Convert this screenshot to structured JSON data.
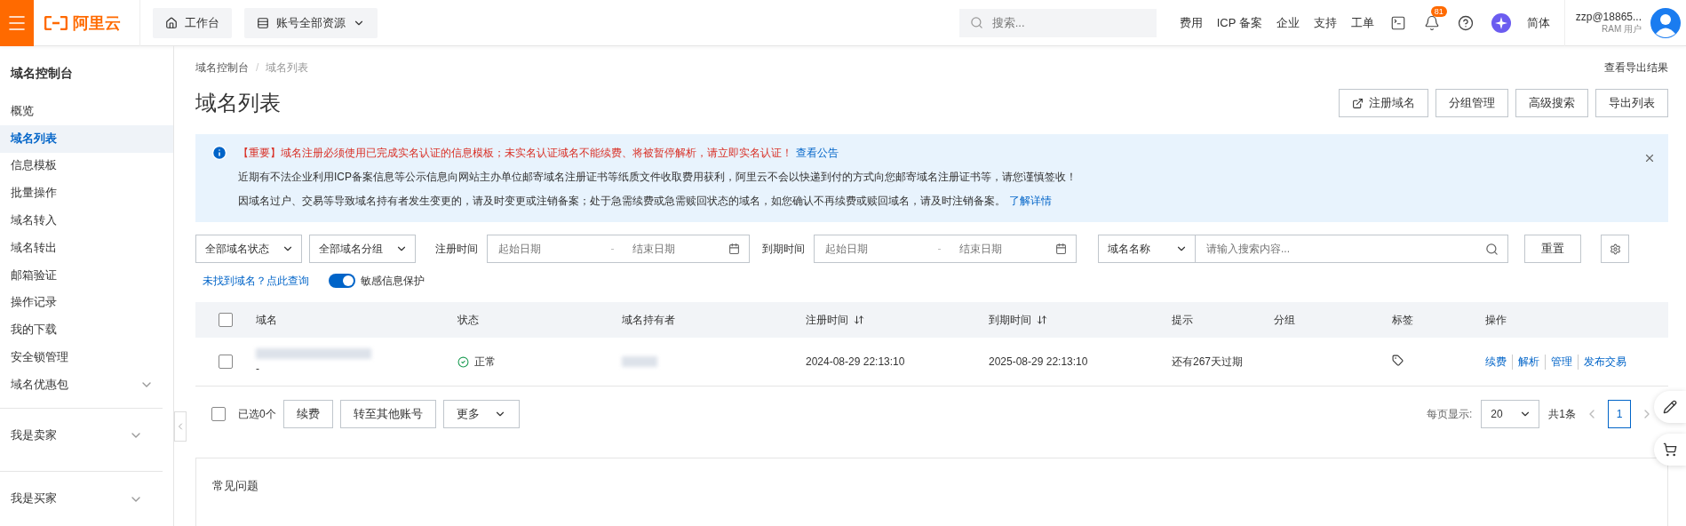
{
  "topbar": {
    "logo": "阿里云",
    "nav_buttons": [
      {
        "label": "工作台",
        "kind": "home"
      },
      {
        "label": "账号全部资源",
        "kind": "dropdown"
      }
    ],
    "search": {
      "placeholder": "搜索..."
    },
    "links": [
      "费用",
      "ICP 备案",
      "企业",
      "支持",
      "工单"
    ],
    "notification_badge": "81",
    "language": "简体",
    "user": {
      "name": "zzp@18865...",
      "role": "RAM 用户"
    }
  },
  "sidebar": {
    "title": "域名控制台",
    "items": [
      {
        "label": "概览",
        "kind": "link",
        "selected": false
      },
      {
        "label": "域名列表",
        "kind": "link",
        "selected": true
      },
      {
        "label": "信息模板",
        "kind": "link",
        "selected": false
      },
      {
        "label": "批量操作",
        "kind": "link",
        "selected": false
      },
      {
        "label": "域名转入",
        "kind": "link",
        "selected": false
      },
      {
        "label": "域名转出",
        "kind": "link",
        "selected": false
      },
      {
        "label": "邮箱验证",
        "kind": "link",
        "selected": false
      },
      {
        "label": "操作记录",
        "kind": "link",
        "selected": false
      },
      {
        "label": "我的下载",
        "kind": "link",
        "selected": false
      },
      {
        "label": "安全锁管理",
        "kind": "link",
        "selected": false
      },
      {
        "label": "域名优惠包",
        "kind": "group",
        "selected": false
      }
    ],
    "sections": [
      "我是卖家",
      "我是买家"
    ]
  },
  "breadcrumb": [
    "域名控制台",
    "域名列表"
  ],
  "breadcrumb_separator": "/",
  "export_link": "查看导出结果",
  "title": "域名列表",
  "actions": [
    {
      "label": "注册域名",
      "kind": "external"
    },
    {
      "label": "分组管理",
      "kind": "plain"
    },
    {
      "label": "高级搜索",
      "kind": "plain"
    },
    {
      "label": "导出列表",
      "kind": "plain"
    }
  ],
  "notice": {
    "lines": [
      {
        "kind": "warning",
        "text": "【重要】域名注册必须使用已完成实名认证的信息模板；未实名认证域名不能续费、将被暂停解析，请立即实名认证！",
        "link": "查看公告"
      },
      {
        "kind": "plain",
        "text": "近期有不法企业利用ICP备案信息等公示信息向网站主办单位邮寄域名注册证书等纸质文件收取费用获利，阿里云不会以快递到付的方式向您邮寄域名注册证书等，请您谨慎签收！"
      },
      {
        "kind": "plain",
        "text": "因域名过户、交易等导致域名持有者发生变更的，请及时变更或注销备案；处于急需续费或急需赎回状态的域名，如您确认不再续费或赎回域名，请及时注销备案。",
        "link": "了解详情"
      }
    ]
  },
  "filters": {
    "status_select": "全部域名状态",
    "group_select": "全部域名分组",
    "date_ranges": [
      {
        "label": "注册时间",
        "start": {
          "placeholder": "起始日期"
        },
        "separator": "-",
        "end": {
          "placeholder": "结束日期"
        }
      },
      {
        "label": "到期时间",
        "start": {
          "placeholder": "起始日期"
        },
        "separator": "-",
        "end": {
          "placeholder": "结束日期"
        }
      }
    ],
    "search_field": {
      "select": "域名名称",
      "placeholder": "请输入搜索内容..."
    },
    "reset": "重置"
  },
  "not_found_link": "未找到域名？点此查询",
  "sensitive_toggle": {
    "label": "敏感信息保护",
    "on": true
  },
  "table": {
    "select_all": {
      "checked": false
    },
    "columns": [
      {
        "label": "域名",
        "sortable": false
      },
      {
        "label": "状态",
        "sortable": false
      },
      {
        "label": "域名持有者",
        "sortable": false
      },
      {
        "label": "注册时间",
        "sortable": true
      },
      {
        "label": "到期时间",
        "sortable": true
      },
      {
        "label": "提示",
        "sortable": false
      },
      {
        "label": "分组",
        "sortable": false
      },
      {
        "label": "标签",
        "sortable": false
      },
      {
        "label": "操作",
        "sortable": false
      }
    ],
    "rows": [
      {
        "selected": false,
        "domain_note": "-",
        "status": "正常",
        "registered": "2024-08-29 22:13:10",
        "expires": "2025-08-29 22:13:10",
        "hint": "还有267天过期",
        "operations": [
          "续费",
          "解析",
          "管理",
          "发布交易"
        ]
      }
    ]
  },
  "footer": {
    "select_all": {
      "checked": false
    },
    "selected_count": "已选0个",
    "buttons": [
      "续费",
      "转至其他账号"
    ],
    "more": "更多",
    "page_size_label": "每页显示:",
    "page_size": "20",
    "total": "共1条",
    "pages": [
      {
        "label": "1",
        "selected": true
      }
    ]
  },
  "faq": {
    "title": "常见问题"
  }
}
